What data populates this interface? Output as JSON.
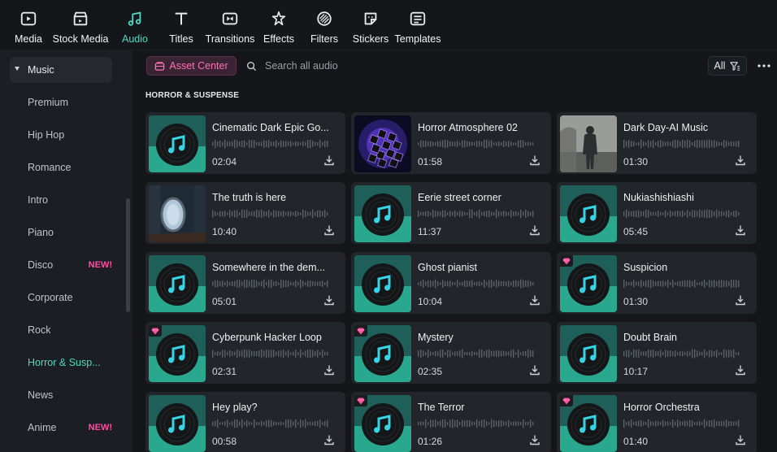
{
  "toolbar": {
    "items": [
      {
        "label": "Media",
        "icon": "media-icon",
        "active": false
      },
      {
        "label": "Stock Media",
        "icon": "stock-media-icon",
        "active": false
      },
      {
        "label": "Audio",
        "icon": "audio-note-icon",
        "active": true
      },
      {
        "label": "Titles",
        "icon": "titles-t-icon",
        "active": false
      },
      {
        "label": "Transitions",
        "icon": "transitions-icon",
        "active": false
      },
      {
        "label": "Effects",
        "icon": "effects-star-icon",
        "active": false
      },
      {
        "label": "Filters",
        "icon": "filters-icon",
        "active": false
      },
      {
        "label": "Stickers",
        "icon": "stickers-icon",
        "active": false
      },
      {
        "label": "Templates",
        "icon": "templates-icon",
        "active": false
      }
    ]
  },
  "sidebar": {
    "parent": "Music",
    "items": [
      {
        "label": "Premium",
        "badge": ""
      },
      {
        "label": "Hip Hop",
        "badge": ""
      },
      {
        "label": "Romance",
        "badge": ""
      },
      {
        "label": "Intro",
        "badge": ""
      },
      {
        "label": "Piano",
        "badge": ""
      },
      {
        "label": "Disco",
        "badge": "NEW!"
      },
      {
        "label": "Corporate",
        "badge": ""
      },
      {
        "label": "Rock",
        "badge": ""
      },
      {
        "label": "Horror & Susp...",
        "badge": "",
        "selected": true
      },
      {
        "label": "News",
        "badge": ""
      },
      {
        "label": "Anime",
        "badge": "NEW!"
      }
    ]
  },
  "header": {
    "asset_center_label": "Asset Center",
    "search_placeholder": "Search all audio",
    "filter_label": "All"
  },
  "section_title": "HORROR & SUSPENSE",
  "tracks": [
    {
      "title": "Cinematic Dark Epic Go...",
      "duration": "02:04",
      "thumb": "disc",
      "premium": false
    },
    {
      "title": "Horror Atmosphere 02",
      "duration": "01:58",
      "thumb": "purple-cubes",
      "premium": false
    },
    {
      "title": "Dark Day-AI Music",
      "duration": "01:30",
      "thumb": "hooded-figure",
      "premium": false
    },
    {
      "title": "The truth is here",
      "duration": "10:40",
      "thumb": "mirror",
      "premium": false
    },
    {
      "title": "Eerie street corner",
      "duration": "11:37",
      "thumb": "disc",
      "premium": false
    },
    {
      "title": "Nukiashishiashi",
      "duration": "05:45",
      "thumb": "disc",
      "premium": false
    },
    {
      "title": "Somewhere in the dem...",
      "duration": "05:01",
      "thumb": "disc",
      "premium": false
    },
    {
      "title": "Ghost pianist",
      "duration": "10:04",
      "thumb": "disc",
      "premium": false
    },
    {
      "title": "Suspicion",
      "duration": "01:30",
      "thumb": "disc",
      "premium": true
    },
    {
      "title": "Cyberpunk Hacker Loop",
      "duration": "02:31",
      "thumb": "disc",
      "premium": true
    },
    {
      "title": "Mystery",
      "duration": "02:35",
      "thumb": "disc",
      "premium": true
    },
    {
      "title": "Doubt Brain",
      "duration": "10:17",
      "thumb": "disc",
      "premium": false
    },
    {
      "title": "Hey play?",
      "duration": "00:58",
      "thumb": "disc",
      "premium": false
    },
    {
      "title": "The Terror",
      "duration": "01:26",
      "thumb": "disc",
      "premium": true
    },
    {
      "title": "Horror Orchestra",
      "duration": "01:40",
      "thumb": "disc",
      "premium": true
    }
  ],
  "colors": {
    "accent": "#4fd8c1",
    "new_badge": "#ff4da6",
    "asset_center": "#ff6fb0",
    "card_bg": "#22262b"
  }
}
